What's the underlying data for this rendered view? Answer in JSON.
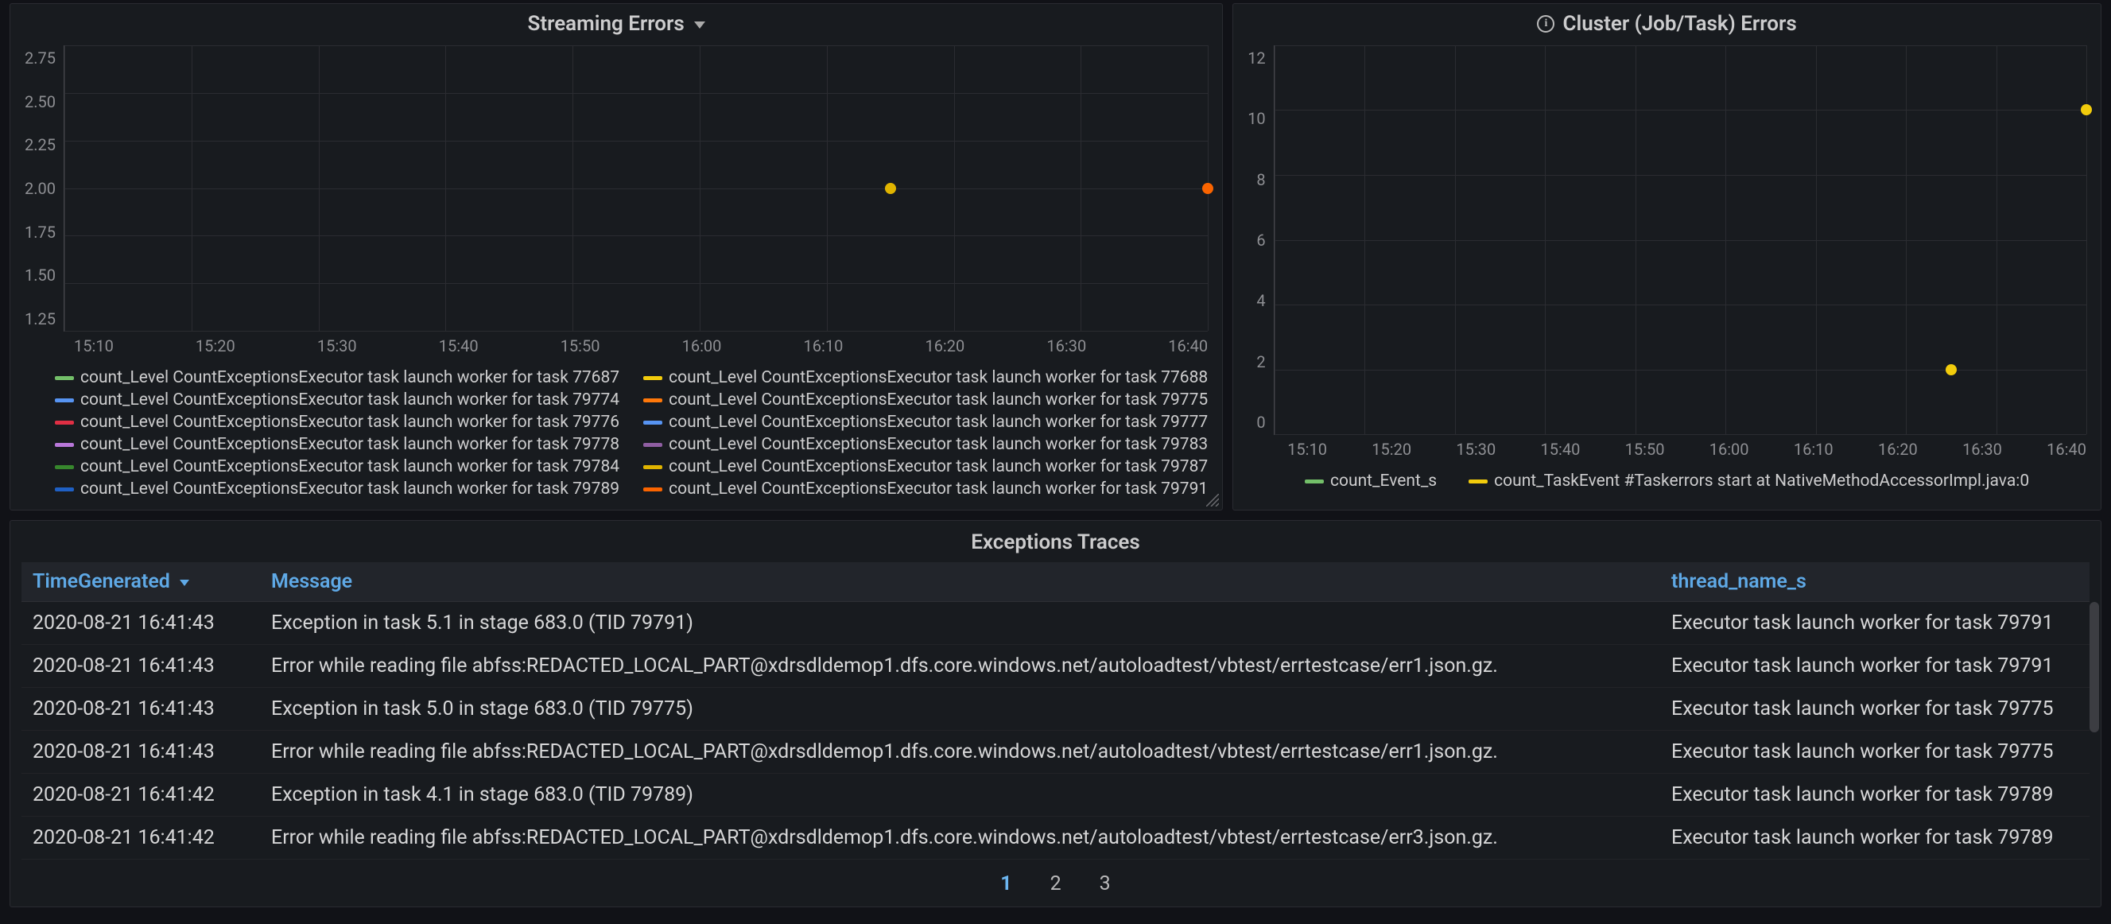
{
  "panels": {
    "streaming": {
      "title": "Streaming Errors",
      "y_ticks": [
        "2.75",
        "2.50",
        "2.25",
        "2.00",
        "1.75",
        "1.50",
        "1.25"
      ],
      "x_ticks": [
        "15:10",
        "15:20",
        "15:30",
        "15:40",
        "15:50",
        "16:00",
        "16:10",
        "16:20",
        "16:30",
        "16:40"
      ],
      "legend": [
        {
          "color": "#73bf69",
          "label": "count_Level CountExceptionsExecutor task launch worker for task 77687"
        },
        {
          "color": "#f2cc0c",
          "label": "count_Level CountExceptionsExecutor task launch worker for task 77688"
        },
        {
          "color": "#5794f2",
          "label": "count_Level CountExceptionsExecutor task launch worker for task 79774"
        },
        {
          "color": "#ff780a",
          "label": "count_Level CountExceptionsExecutor task launch worker for task 79775"
        },
        {
          "color": "#e02f44",
          "label": "count_Level CountExceptionsExecutor task launch worker for task 79776"
        },
        {
          "color": "#5794f2",
          "label": "count_Level CountExceptionsExecutor task launch worker for task 79777"
        },
        {
          "color": "#b877d9",
          "label": "count_Level CountExceptionsExecutor task launch worker for task 79778"
        },
        {
          "color": "#8f5ea2",
          "label": "count_Level CountExceptionsExecutor task launch worker for task 79783"
        },
        {
          "color": "#37872d",
          "label": "count_Level CountExceptionsExecutor task launch worker for task 79784"
        },
        {
          "color": "#e0b400",
          "label": "count_Level CountExceptionsExecutor task launch worker for task 79787"
        },
        {
          "color": "#1f60c4",
          "label": "count_Level CountExceptionsExecutor task launch worker for task 79789"
        },
        {
          "color": "#fa6400",
          "label": "count_Level CountExceptionsExecutor task launch worker for task 79791"
        }
      ]
    },
    "cluster": {
      "title": "Cluster (Job/Task) Errors",
      "y_ticks": [
        "12",
        "10",
        "8",
        "6",
        "4",
        "2",
        "0"
      ],
      "x_ticks": [
        "15:10",
        "15:20",
        "15:30",
        "15:40",
        "15:50",
        "16:00",
        "16:10",
        "16:20",
        "16:30",
        "16:40"
      ],
      "legend": [
        {
          "color": "#73bf69",
          "label": "count_Event_s"
        },
        {
          "color": "#f2cc0c",
          "label": "count_TaskEvent #Taskerrors start at NativeMethodAccessorImpl.java:0"
        }
      ]
    }
  },
  "chart_data": [
    {
      "type": "scatter",
      "title": "Streaming Errors",
      "xlabel": "",
      "ylabel": "",
      "x_ticks": [
        "15:10",
        "15:20",
        "15:30",
        "15:40",
        "15:50",
        "16:00",
        "16:10",
        "16:20",
        "16:30",
        "16:40"
      ],
      "ylim": [
        1.25,
        2.75
      ],
      "series": [
        {
          "name": "count_Level CountExceptionsExecutor task launch worker for task 79787",
          "color": "#e0b400",
          "points": [
            {
              "x": "16:15",
              "y": 2.0
            }
          ]
        },
        {
          "name": "count_Level CountExceptionsExecutor task launch worker for task 79791",
          "color": "#fa6400",
          "points": [
            {
              "x": "16:40",
              "y": 2.0
            }
          ]
        }
      ]
    },
    {
      "type": "scatter",
      "title": "Cluster (Job/Task) Errors",
      "xlabel": "",
      "ylabel": "",
      "x_ticks": [
        "15:10",
        "15:20",
        "15:30",
        "15:40",
        "15:50",
        "16:00",
        "16:10",
        "16:20",
        "16:30",
        "16:40"
      ],
      "ylim": [
        0,
        12
      ],
      "series": [
        {
          "name": "count_TaskEvent #Taskerrors start at NativeMethodAccessorImpl.java:0",
          "color": "#f2cc0c",
          "points": [
            {
              "x": "16:25",
              "y": 2
            },
            {
              "x": "16:40",
              "y": 10
            }
          ]
        }
      ]
    }
  ],
  "table": {
    "title": "Exceptions Traces",
    "columns": {
      "time": "TimeGenerated",
      "message": "Message",
      "thread": "thread_name_s"
    },
    "sort_column": "TimeGenerated",
    "sort_dir": "desc",
    "rows": [
      {
        "time": "2020-08-21 16:41:43",
        "message": "Exception in task 5.1 in stage 683.0 (TID 79791)",
        "thread": "Executor task launch worker for task 79791"
      },
      {
        "time": "2020-08-21 16:41:43",
        "message": "Error while reading file abfss:REDACTED_LOCAL_PART@xdrsdldemop1.dfs.core.windows.net/autoloadtest/vbtest/errtestcase/err1.json.gz.",
        "thread": "Executor task launch worker for task 79791"
      },
      {
        "time": "2020-08-21 16:41:43",
        "message": "Exception in task 5.0 in stage 683.0 (TID 79775)",
        "thread": "Executor task launch worker for task 79775"
      },
      {
        "time": "2020-08-21 16:41:43",
        "message": "Error while reading file abfss:REDACTED_LOCAL_PART@xdrsdldemop1.dfs.core.windows.net/autoloadtest/vbtest/errtestcase/err1.json.gz.",
        "thread": "Executor task launch worker for task 79775"
      },
      {
        "time": "2020-08-21 16:41:42",
        "message": "Exception in task 4.1 in stage 683.0 (TID 79789)",
        "thread": "Executor task launch worker for task 79789"
      },
      {
        "time": "2020-08-21 16:41:42",
        "message": "Error while reading file abfss:REDACTED_LOCAL_PART@xdrsdldemop1.dfs.core.windows.net/autoloadtest/vbtest/errtestcase/err3.json.gz.",
        "thread": "Executor task launch worker for task 79789"
      }
    ],
    "pages": [
      "1",
      "2",
      "3"
    ],
    "current_page": "1"
  }
}
